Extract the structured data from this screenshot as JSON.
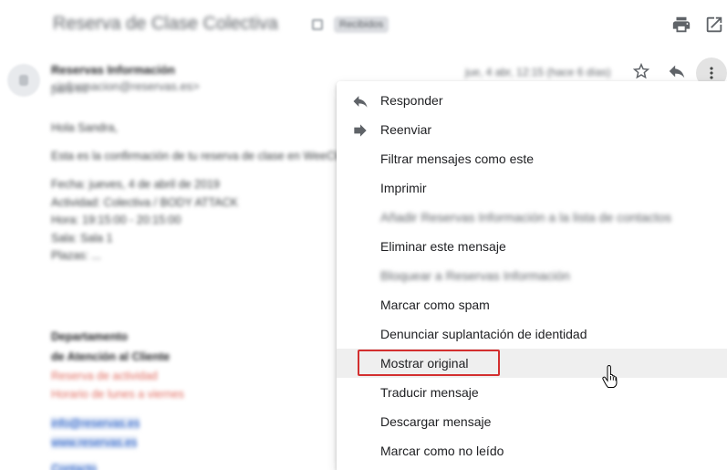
{
  "email": {
    "subject": "Reserva de Clase Colectiva",
    "label": "Recibidos",
    "sender_name": "Reservas Información",
    "sender_address": "<informacion@reservas.es>",
    "recipient": "para mí",
    "date": "jue, 4 abr, 12:15 (hace 6 días)"
  },
  "toolbar": {
    "print_icon": "print-icon",
    "open_new_window_icon": "open-in-new-icon",
    "star_icon": "star-icon",
    "reply_icon": "reply-icon",
    "more_icon": "more-vert-icon"
  },
  "body": {
    "greeting": "Hola Sandra,",
    "intro": "Esta es la confirmación de tu reserva de clase en WeeClub",
    "details": [
      "Fecha: jueves, 4 de abril de 2019",
      "Actividad: Colectiva / BODY ATTACK",
      "Hora: 19:15:00 - 20:15:00",
      "Sala: Sala 1",
      "Plazas: ..."
    ],
    "sign_lines": [
      "Departamento",
      "de Atención al Cliente"
    ],
    "red_lines": [
      "Reserva de actividad",
      "Horario de lunes a viernes"
    ],
    "link_lines": [
      "info@reservas.es",
      "www.reservas.es"
    ],
    "footer": "Contacto"
  },
  "menu": {
    "items": [
      {
        "label": "Responder",
        "icon": "reply-icon"
      },
      {
        "label": "Reenviar",
        "icon": "forward-icon"
      },
      {
        "label": "Filtrar mensajes como este"
      },
      {
        "label": "Imprimir"
      },
      {
        "label": "Añadir Reservas Información a la lista de contactos"
      },
      {
        "label": "Eliminar este mensaje"
      },
      {
        "label": "Bloquear a Reservas Información"
      },
      {
        "label": "Marcar como spam"
      },
      {
        "label": "Denunciar suplantación de identidad"
      },
      {
        "label": "Mostrar original"
      },
      {
        "label": "Traducir mensaje"
      },
      {
        "label": "Descargar mensaje"
      },
      {
        "label": "Marcar como no leído"
      }
    ]
  },
  "colors": {
    "highlight_row": "#efefef",
    "annotation_border": "#d32f2f",
    "icon_grey": "#5f6368"
  }
}
